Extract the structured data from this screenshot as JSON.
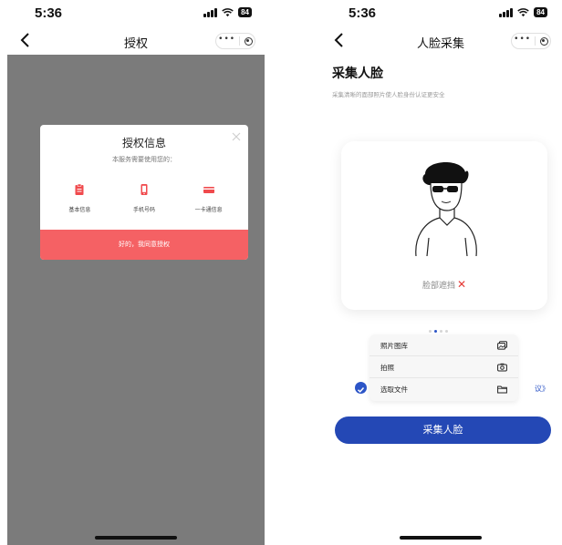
{
  "left": {
    "status": {
      "time": "5:36",
      "battery": "84"
    },
    "navbar": {
      "title": "授权"
    },
    "auth_modal": {
      "title": "授权信息",
      "subtitle": "本服务需要使用您的：",
      "permissions": [
        {
          "label": "基本信息",
          "icon": "clipboard-icon"
        },
        {
          "label": "手机号码",
          "icon": "phone-icon"
        },
        {
          "label": "一卡通信息",
          "icon": "card-icon"
        }
      ],
      "agree_button": "好的，我同意授权"
    }
  },
  "right": {
    "status": {
      "time": "5:36",
      "battery": "84"
    },
    "navbar": {
      "title": "人脸采集"
    },
    "page_title": "采集人脸",
    "page_desc": "采集清晰的面部照片使人脸身份认证更安全",
    "face_status": "脸部遮挡",
    "popup_menu": [
      {
        "label": "照片图库",
        "icon": "photo-library-icon"
      },
      {
        "label": "拍照",
        "icon": "camera-icon"
      },
      {
        "label": "选取文件",
        "icon": "folder-icon"
      }
    ],
    "agreement_tail": "议》",
    "collect_button": "采集人脸"
  },
  "colors": {
    "accent_red": "#f56164",
    "accent_blue": "#2448b5",
    "overlay_gray": "#7b7b7b",
    "error_red": "#e53935"
  }
}
